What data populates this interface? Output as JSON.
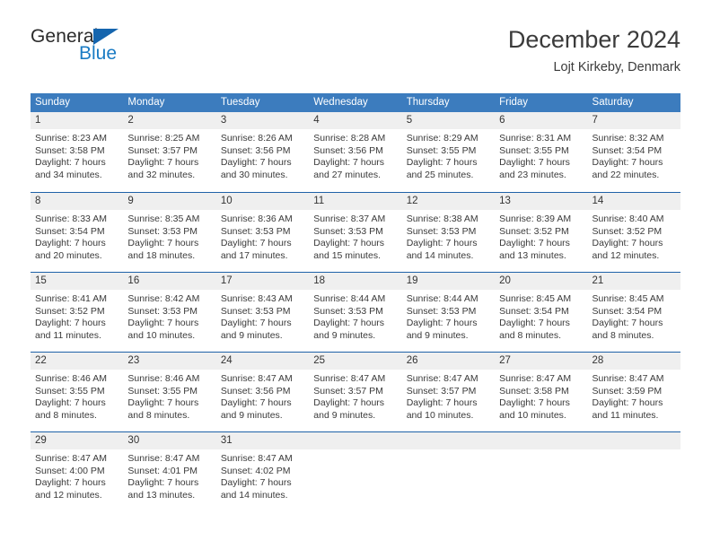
{
  "brand": {
    "name_part1": "General",
    "name_part2": "Blue",
    "flag_icon": "triangle-flag-icon",
    "accent_color": "#1a7bc4",
    "flag_color": "#1565ae"
  },
  "header": {
    "month_title": "December 2024",
    "location": "Lojt Kirkeby, Denmark"
  },
  "calendar": {
    "header_color": "#3c7cbe",
    "separator_color": "#1f62a8",
    "day_band_color": "#efefef",
    "weekdays": [
      "Sunday",
      "Monday",
      "Tuesday",
      "Wednesday",
      "Thursday",
      "Friday",
      "Saturday"
    ],
    "weeks": [
      [
        {
          "day": "1",
          "sunrise": "Sunrise: 8:23 AM",
          "sunset": "Sunset: 3:58 PM",
          "daylight_line1": "Daylight: 7 hours",
          "daylight_line2": "and 34 minutes."
        },
        {
          "day": "2",
          "sunrise": "Sunrise: 8:25 AM",
          "sunset": "Sunset: 3:57 PM",
          "daylight_line1": "Daylight: 7 hours",
          "daylight_line2": "and 32 minutes."
        },
        {
          "day": "3",
          "sunrise": "Sunrise: 8:26 AM",
          "sunset": "Sunset: 3:56 PM",
          "daylight_line1": "Daylight: 7 hours",
          "daylight_line2": "and 30 minutes."
        },
        {
          "day": "4",
          "sunrise": "Sunrise: 8:28 AM",
          "sunset": "Sunset: 3:56 PM",
          "daylight_line1": "Daylight: 7 hours",
          "daylight_line2": "and 27 minutes."
        },
        {
          "day": "5",
          "sunrise": "Sunrise: 8:29 AM",
          "sunset": "Sunset: 3:55 PM",
          "daylight_line1": "Daylight: 7 hours",
          "daylight_line2": "and 25 minutes."
        },
        {
          "day": "6",
          "sunrise": "Sunrise: 8:31 AM",
          "sunset": "Sunset: 3:55 PM",
          "daylight_line1": "Daylight: 7 hours",
          "daylight_line2": "and 23 minutes."
        },
        {
          "day": "7",
          "sunrise": "Sunrise: 8:32 AM",
          "sunset": "Sunset: 3:54 PM",
          "daylight_line1": "Daylight: 7 hours",
          "daylight_line2": "and 22 minutes."
        }
      ],
      [
        {
          "day": "8",
          "sunrise": "Sunrise: 8:33 AM",
          "sunset": "Sunset: 3:54 PM",
          "daylight_line1": "Daylight: 7 hours",
          "daylight_line2": "and 20 minutes."
        },
        {
          "day": "9",
          "sunrise": "Sunrise: 8:35 AM",
          "sunset": "Sunset: 3:53 PM",
          "daylight_line1": "Daylight: 7 hours",
          "daylight_line2": "and 18 minutes."
        },
        {
          "day": "10",
          "sunrise": "Sunrise: 8:36 AM",
          "sunset": "Sunset: 3:53 PM",
          "daylight_line1": "Daylight: 7 hours",
          "daylight_line2": "and 17 minutes."
        },
        {
          "day": "11",
          "sunrise": "Sunrise: 8:37 AM",
          "sunset": "Sunset: 3:53 PM",
          "daylight_line1": "Daylight: 7 hours",
          "daylight_line2": "and 15 minutes."
        },
        {
          "day": "12",
          "sunrise": "Sunrise: 8:38 AM",
          "sunset": "Sunset: 3:53 PM",
          "daylight_line1": "Daylight: 7 hours",
          "daylight_line2": "and 14 minutes."
        },
        {
          "day": "13",
          "sunrise": "Sunrise: 8:39 AM",
          "sunset": "Sunset: 3:52 PM",
          "daylight_line1": "Daylight: 7 hours",
          "daylight_line2": "and 13 minutes."
        },
        {
          "day": "14",
          "sunrise": "Sunrise: 8:40 AM",
          "sunset": "Sunset: 3:52 PM",
          "daylight_line1": "Daylight: 7 hours",
          "daylight_line2": "and 12 minutes."
        }
      ],
      [
        {
          "day": "15",
          "sunrise": "Sunrise: 8:41 AM",
          "sunset": "Sunset: 3:52 PM",
          "daylight_line1": "Daylight: 7 hours",
          "daylight_line2": "and 11 minutes."
        },
        {
          "day": "16",
          "sunrise": "Sunrise: 8:42 AM",
          "sunset": "Sunset: 3:53 PM",
          "daylight_line1": "Daylight: 7 hours",
          "daylight_line2": "and 10 minutes."
        },
        {
          "day": "17",
          "sunrise": "Sunrise: 8:43 AM",
          "sunset": "Sunset: 3:53 PM",
          "daylight_line1": "Daylight: 7 hours",
          "daylight_line2": "and 9 minutes."
        },
        {
          "day": "18",
          "sunrise": "Sunrise: 8:44 AM",
          "sunset": "Sunset: 3:53 PM",
          "daylight_line1": "Daylight: 7 hours",
          "daylight_line2": "and 9 minutes."
        },
        {
          "day": "19",
          "sunrise": "Sunrise: 8:44 AM",
          "sunset": "Sunset: 3:53 PM",
          "daylight_line1": "Daylight: 7 hours",
          "daylight_line2": "and 9 minutes."
        },
        {
          "day": "20",
          "sunrise": "Sunrise: 8:45 AM",
          "sunset": "Sunset: 3:54 PM",
          "daylight_line1": "Daylight: 7 hours",
          "daylight_line2": "and 8 minutes."
        },
        {
          "day": "21",
          "sunrise": "Sunrise: 8:45 AM",
          "sunset": "Sunset: 3:54 PM",
          "daylight_line1": "Daylight: 7 hours",
          "daylight_line2": "and 8 minutes."
        }
      ],
      [
        {
          "day": "22",
          "sunrise": "Sunrise: 8:46 AM",
          "sunset": "Sunset: 3:55 PM",
          "daylight_line1": "Daylight: 7 hours",
          "daylight_line2": "and 8 minutes."
        },
        {
          "day": "23",
          "sunrise": "Sunrise: 8:46 AM",
          "sunset": "Sunset: 3:55 PM",
          "daylight_line1": "Daylight: 7 hours",
          "daylight_line2": "and 8 minutes."
        },
        {
          "day": "24",
          "sunrise": "Sunrise: 8:47 AM",
          "sunset": "Sunset: 3:56 PM",
          "daylight_line1": "Daylight: 7 hours",
          "daylight_line2": "and 9 minutes."
        },
        {
          "day": "25",
          "sunrise": "Sunrise: 8:47 AM",
          "sunset": "Sunset: 3:57 PM",
          "daylight_line1": "Daylight: 7 hours",
          "daylight_line2": "and 9 minutes."
        },
        {
          "day": "26",
          "sunrise": "Sunrise: 8:47 AM",
          "sunset": "Sunset: 3:57 PM",
          "daylight_line1": "Daylight: 7 hours",
          "daylight_line2": "and 10 minutes."
        },
        {
          "day": "27",
          "sunrise": "Sunrise: 8:47 AM",
          "sunset": "Sunset: 3:58 PM",
          "daylight_line1": "Daylight: 7 hours",
          "daylight_line2": "and 10 minutes."
        },
        {
          "day": "28",
          "sunrise": "Sunrise: 8:47 AM",
          "sunset": "Sunset: 3:59 PM",
          "daylight_line1": "Daylight: 7 hours",
          "daylight_line2": "and 11 minutes."
        }
      ],
      [
        {
          "day": "29",
          "sunrise": "Sunrise: 8:47 AM",
          "sunset": "Sunset: 4:00 PM",
          "daylight_line1": "Daylight: 7 hours",
          "daylight_line2": "and 12 minutes."
        },
        {
          "day": "30",
          "sunrise": "Sunrise: 8:47 AM",
          "sunset": "Sunset: 4:01 PM",
          "daylight_line1": "Daylight: 7 hours",
          "daylight_line2": "and 13 minutes."
        },
        {
          "day": "31",
          "sunrise": "Sunrise: 8:47 AM",
          "sunset": "Sunset: 4:02 PM",
          "daylight_line1": "Daylight: 7 hours",
          "daylight_line2": "and 14 minutes."
        },
        {
          "day": "",
          "sunrise": "",
          "sunset": "",
          "daylight_line1": "",
          "daylight_line2": ""
        },
        {
          "day": "",
          "sunrise": "",
          "sunset": "",
          "daylight_line1": "",
          "daylight_line2": ""
        },
        {
          "day": "",
          "sunrise": "",
          "sunset": "",
          "daylight_line1": "",
          "daylight_line2": ""
        },
        {
          "day": "",
          "sunrise": "",
          "sunset": "",
          "daylight_line1": "",
          "daylight_line2": ""
        }
      ]
    ]
  }
}
